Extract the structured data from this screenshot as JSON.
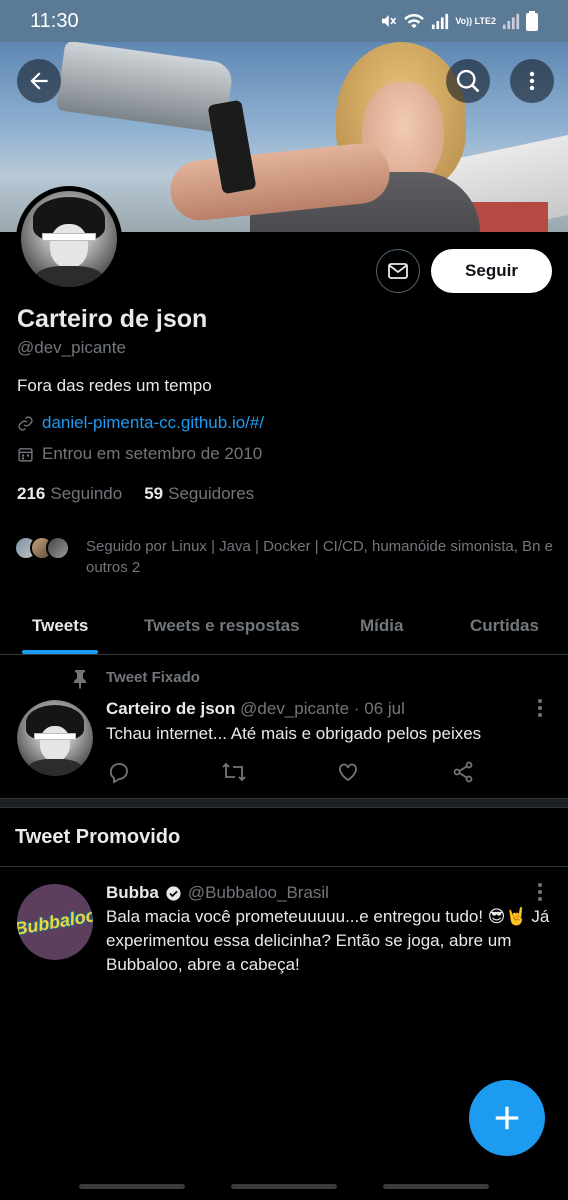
{
  "status_bar": {
    "time": "11:30",
    "network": "Vo)) LTE2"
  },
  "profile": {
    "name": "Carteiro de json",
    "handle": "@dev_picante",
    "bio": "Fora das redes um tempo",
    "link": "daniel-pimenta-cc.github.io/#/",
    "joined": "Entrou em setembro de 2010",
    "following_count": "216",
    "following_label": "Seguindo",
    "followers_count": "59",
    "followers_label": "Seguidores",
    "followed_by": "Seguido por Linux | Java | Docker | CI/CD, humanóide simonista, Bn e outros 2",
    "follow_label": "Seguir"
  },
  "tabs": [
    {
      "label": "Tweets",
      "active": true
    },
    {
      "label": "Tweets e respostas",
      "active": false
    },
    {
      "label": "Mídia",
      "active": false
    },
    {
      "label": "Curtidas",
      "active": false
    }
  ],
  "pinned_tweet": {
    "pinned_label": "Tweet Fixado",
    "author": "Carteiro de json",
    "handle": "@dev_picante",
    "dot": "·",
    "date": "06 jul",
    "text": "Tchau internet... Até mais e obrigado pelos peixes"
  },
  "promoted": {
    "section_title": "Tweet Promovido",
    "author": "Bubba",
    "handle": "@Bubbaloo_Brasil",
    "logo_text": "Bubbaloo",
    "text": "Bala macia você prometeuuuuu...e entregou tudo! 😎🤘 Já experimentou essa delicinha? Então se joga,  abre um Bubbaloo, abre a cabeça!"
  },
  "colors": {
    "accent": "#1d9bf0",
    "background": "#000000",
    "muted": "#71767b",
    "status_bar": "#5a7a96"
  }
}
